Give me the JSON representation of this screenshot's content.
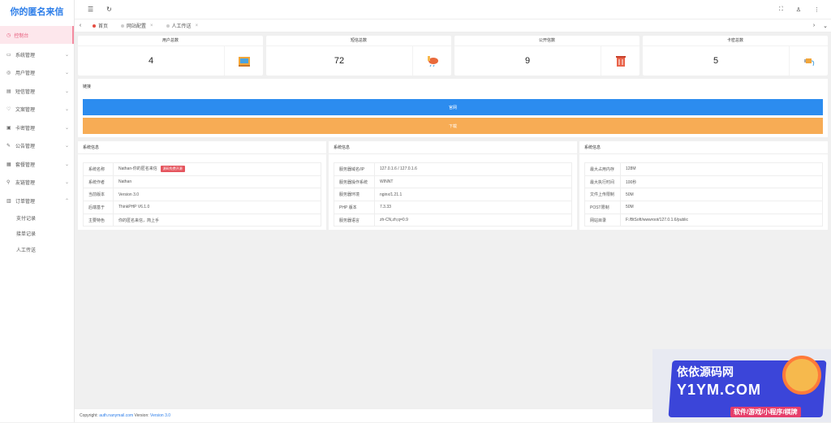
{
  "sidebar": {
    "logo": "你的匿名来信",
    "home": "控制台",
    "items": [
      {
        "label": "系统管理",
        "icon": "monitor-icon"
      },
      {
        "label": "用户管理",
        "icon": "user-icon"
      },
      {
        "label": "短信管理",
        "icon": "message-icon"
      },
      {
        "label": "文案管理",
        "icon": "heart-icon"
      },
      {
        "label": "卡密管理",
        "icon": "card-icon"
      },
      {
        "label": "公告管理",
        "icon": "edit-icon"
      },
      {
        "label": "套餐管理",
        "icon": "grid-icon"
      },
      {
        "label": "友链管理",
        "icon": "link-icon"
      },
      {
        "label": "订单管理",
        "icon": "order-icon"
      }
    ],
    "subitems": [
      "支付记录",
      "接单记录",
      "人工传送"
    ]
  },
  "tabs": [
    "首页",
    "网站配置",
    "人工传送"
  ],
  "stats": [
    {
      "title": "用户总数",
      "value": "4"
    },
    {
      "title": "短信总数",
      "value": "72"
    },
    {
      "title": "公开信数",
      "value": "9"
    },
    {
      "title": "卡密总数",
      "value": "5"
    }
  ],
  "links": {
    "title": "链接",
    "btn1": "官网",
    "btn2": "下载"
  },
  "info_left": {
    "title": "系统信息",
    "rows": [
      {
        "k": "系统名称",
        "v": "Nathan-你的匿名来信",
        "badge": "源码免费开源"
      },
      {
        "k": "系统作者",
        "v": "Nathan"
      },
      {
        "k": "当前版本",
        "v": "Version 3.0"
      },
      {
        "k": "后端基于",
        "v": "ThinkPHP V6.1.0"
      },
      {
        "k": "主要特色",
        "v": "你的匿名来信，简上手"
      }
    ]
  },
  "info_mid": {
    "title": "系统信息",
    "rows": [
      {
        "k": "服务器域名/IP",
        "v": "127.0.1.6 / 127.0.1.6"
      },
      {
        "k": "服务器操作系统",
        "v": "WINNT"
      },
      {
        "k": "服务器环境",
        "v": "nginx/1.21.1"
      },
      {
        "k": "PHP 版本",
        "v": "7.3.33"
      },
      {
        "k": "服务器语言",
        "v": "zh-CN,zh;q=0.9"
      }
    ]
  },
  "info_right": {
    "title": "系统信息",
    "rows": [
      {
        "k": "最大占用内存",
        "v": "128M"
      },
      {
        "k": "最大执行时间",
        "v": "100秒"
      },
      {
        "k": "文件上传限制",
        "v": "50M"
      },
      {
        "k": "POST限制",
        "v": "50M"
      },
      {
        "k": "网站目录",
        "v": "F:/BtSoft/wwwroot/127.0.1.6/public"
      }
    ]
  },
  "footer": {
    "copyright": "Copyright:",
    "site": "auth.nanymail.com",
    "version_label": "Version:",
    "version": "Version 3.0"
  },
  "promo": {
    "line1": "依依源码网",
    "line2": "Y1YM.COM",
    "line3": "软件/游戏/小程序/棋牌"
  }
}
